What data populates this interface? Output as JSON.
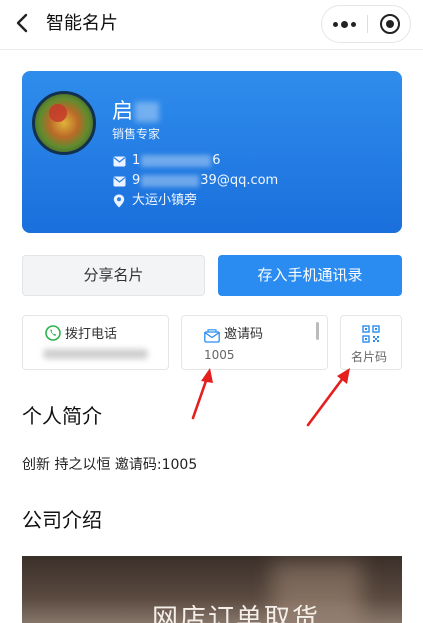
{
  "nav": {
    "title": "智能名片"
  },
  "card": {
    "name": "启",
    "role": "销售专家",
    "phone_start": "1",
    "phone_end": "6",
    "email_start": "9",
    "email_end": "39@qq.com",
    "address": "大运小镇旁",
    "colors": {
      "gradient_top": "#2f8dec",
      "gradient_bottom": "#1a6fdc"
    }
  },
  "buttons": {
    "share_label": "分享名片",
    "save_label": "存入手机通讯录"
  },
  "actions": {
    "call_label": "拨打电话",
    "invite_label": "邀请码",
    "invite_code": "1005",
    "qr_label": "名片码"
  },
  "intro": {
    "heading": "个人简介",
    "text": "创新 持之以恒 邀请码:1005"
  },
  "company": {
    "heading": "公司介绍",
    "image_text": "网店订单取货"
  },
  "icons": {
    "back": "back-icon",
    "more": "more-icon",
    "close": "close-icon",
    "phone": "phone-icon",
    "email": "email-icon",
    "location": "location-icon",
    "call": "call-icon",
    "invite": "envelope-icon",
    "qr": "qr-code-icon"
  }
}
